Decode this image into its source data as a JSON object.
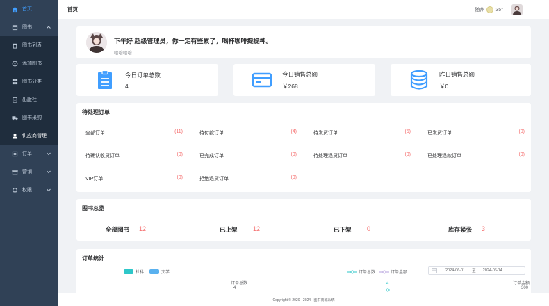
{
  "sidebar": {
    "items": [
      {
        "label": "首页",
        "icon": "home-icon",
        "active": true
      },
      {
        "label": "图书",
        "icon": "book-icon",
        "expanded": true
      },
      {
        "label": "图书列表",
        "icon": "trash-icon",
        "sub": true
      },
      {
        "label": "添加图书",
        "icon": "plus-circle-icon",
        "sub": true
      },
      {
        "label": "图书分类",
        "icon": "grid-icon",
        "sub": true
      },
      {
        "label": "出版社",
        "icon": "building-icon",
        "sub": true
      },
      {
        "label": "图书采购",
        "icon": "truck-icon",
        "sub": true
      },
      {
        "label": "供应商管理",
        "icon": "user-icon",
        "sub": true
      },
      {
        "label": "订单",
        "icon": "list-icon"
      },
      {
        "label": "营销",
        "icon": "gift-icon"
      },
      {
        "label": "权限",
        "icon": "bell-icon"
      }
    ]
  },
  "header": {
    "breadcrumb": "首页",
    "city": "随州",
    "temperature": "35°"
  },
  "welcome": {
    "greeting": "下午好 超级管理员，你一定有些累了，喝杯咖啡提提神。",
    "subtitle": "哈哈哈哈"
  },
  "stats": [
    {
      "label": "今日订单总数",
      "value": "4",
      "icon": "clipboard-icon"
    },
    {
      "label": "今日销售总额",
      "value": "￥268",
      "icon": "credit-card-icon"
    },
    {
      "label": "昨日销售总额",
      "value": "￥0",
      "icon": "database-icon"
    }
  ],
  "orders": {
    "title": "待处理订单",
    "items": [
      {
        "label": "全部订单",
        "count": "(11)"
      },
      {
        "label": "待付款订单",
        "count": "(4)"
      },
      {
        "label": "待发货订单",
        "count": "(5)"
      },
      {
        "label": "已发货订单",
        "count": "(0)"
      },
      {
        "label": "待确认收货订单",
        "count": "(0)"
      },
      {
        "label": "已完成订单",
        "count": "(0)"
      },
      {
        "label": "待处理退货订单",
        "count": "(0)"
      },
      {
        "label": "已处理退款订单",
        "count": "(0)"
      },
      {
        "label": "VIP订单",
        "count": "(0)"
      },
      {
        "label": "拒绝退货订单",
        "count": "(0)"
      }
    ]
  },
  "books": {
    "title": "图书总览",
    "items": [
      {
        "label": "全部图书",
        "value": "12"
      },
      {
        "label": "已上架",
        "value": "12"
      },
      {
        "label": "已下架",
        "value": "0"
      },
      {
        "label": "库存紧张",
        "value": "3"
      }
    ]
  },
  "order_stats": {
    "title": "订单统计",
    "pie_legend": [
      {
        "name": "社科",
        "color": "#2ec7c9"
      },
      {
        "name": "文学",
        "color": "#5ab1ef"
      }
    ],
    "line_legend": [
      "订单总数",
      "订单金额"
    ],
    "date_start": "2024-06-01",
    "date_sep": "至",
    "date_end": "2024-06-14",
    "y_left_label": "订单总数",
    "y_right_label": "订单金额",
    "y_left_max": "4",
    "y_right_max": "300",
    "peak_label": "4"
  },
  "footer": {
    "text": "Copyright © 2020 - 2024 · 图书商城系统"
  },
  "colors": {
    "sidebar_bg": "#304156",
    "accent": "#409eff",
    "count_red": "#f56c6c",
    "icon_blue": "#409eff"
  }
}
